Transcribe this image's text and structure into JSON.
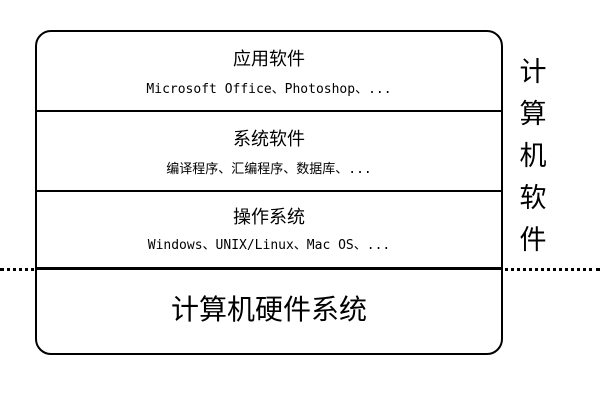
{
  "layers": {
    "application": {
      "title": "应用软件",
      "examples": "Microsoft Office、Photoshop、..."
    },
    "system": {
      "title": "系统软件",
      "examples": "编译程序、汇编程序、数据库、..."
    },
    "os": {
      "title": "操作系统",
      "examples": "Windows、UNIX/Linux、Mac OS、..."
    },
    "hardware": {
      "title": "计算机硬件系统"
    }
  },
  "side_label": {
    "chars": [
      "计",
      "算",
      "机",
      "软",
      "件"
    ]
  }
}
